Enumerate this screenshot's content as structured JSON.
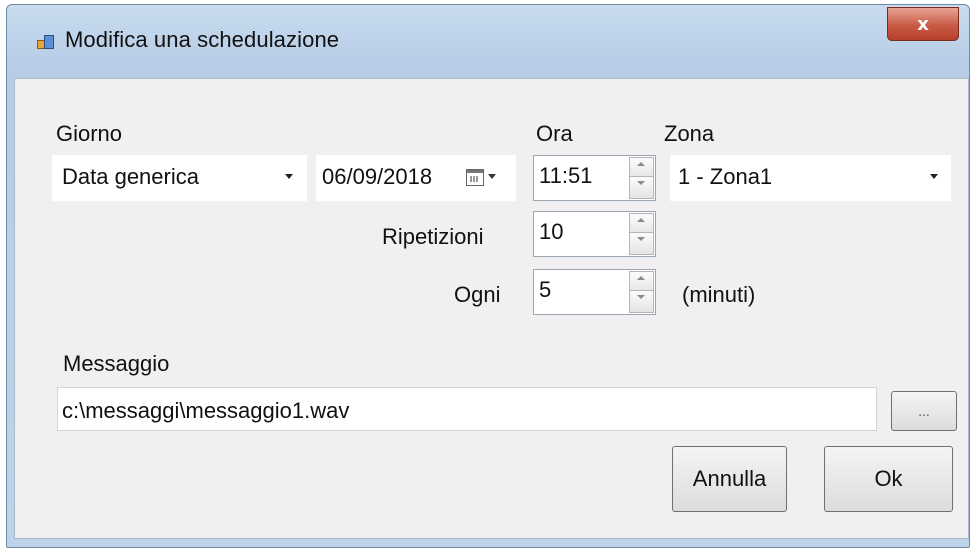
{
  "window": {
    "title": "Modifica una schedulazione",
    "close_label": "x"
  },
  "icons": {
    "app": "app-window-icon",
    "close": "close-icon",
    "calendar": "calendar-icon",
    "dropdown": "chevron-down-icon",
    "spin_up": "arrow-up-icon",
    "spin_down": "arrow-down-icon"
  },
  "form": {
    "giorno_label": "Giorno",
    "giorno_value": "Data generica",
    "date_value": "06/09/2018",
    "ora_label": "Ora",
    "ora_value": "11:51",
    "zona_label": "Zona",
    "zona_value": "1 - Zona1",
    "ripetizioni_label": "Ripetizioni",
    "ripetizioni_value": "10",
    "ogni_label": "Ogni",
    "ogni_value": "5",
    "minuti_label": "(minuti)",
    "messaggio_label": "Messaggio",
    "messaggio_value": "c:\\messaggi\\messaggio1.wav"
  },
  "buttons": {
    "browse_label": "...",
    "cancel_label": "Annulla",
    "ok_label": "Ok"
  },
  "colors": {
    "titlebar": "#bed3ea",
    "client": "#f0f0f0",
    "close": "#c75a45"
  }
}
